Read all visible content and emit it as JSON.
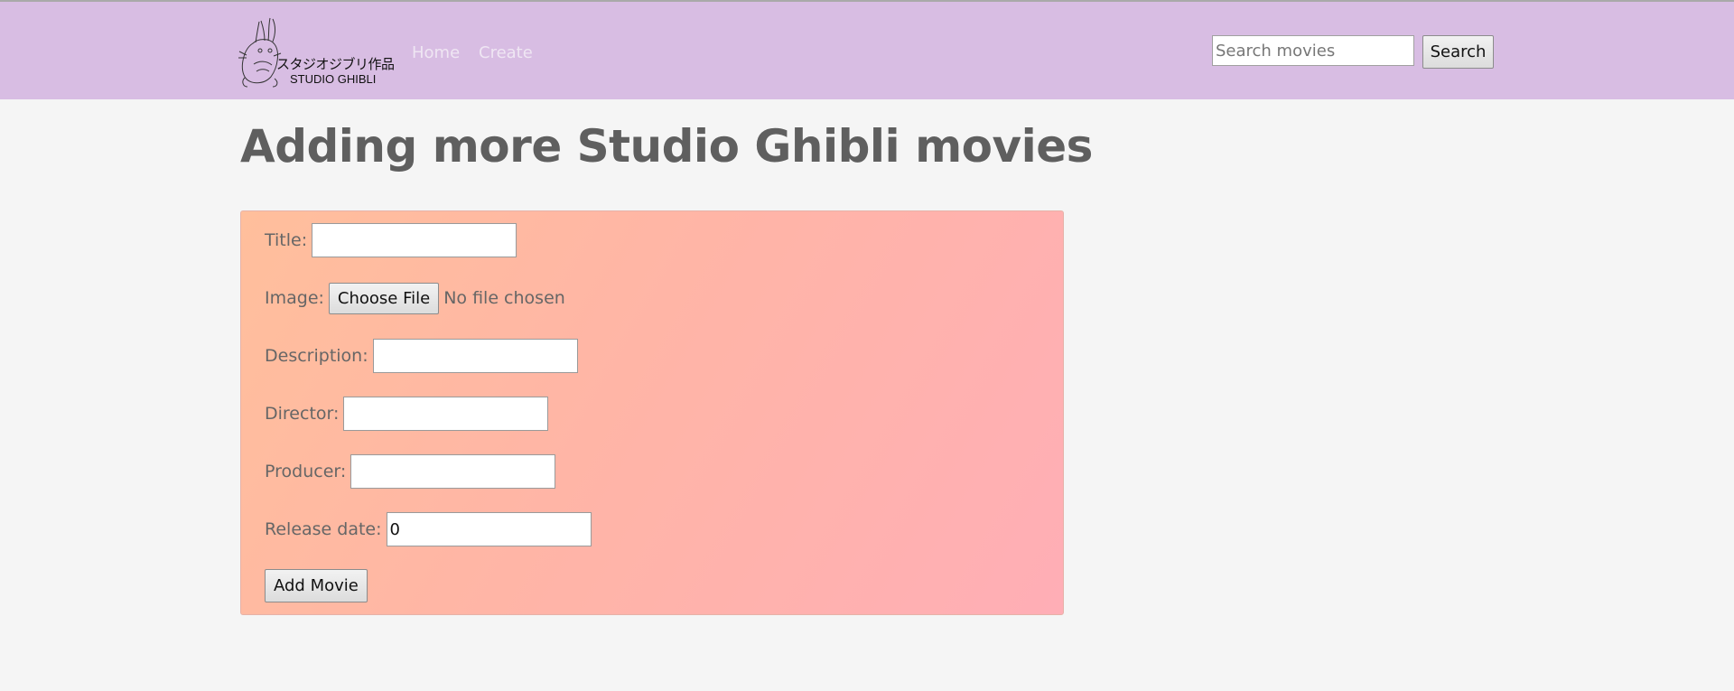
{
  "brand": {
    "logo_icon": "totoro-sketch-icon",
    "japanese_text": "スタジオジブリ作品",
    "english_text": "STUDIO GHIBLI"
  },
  "nav": {
    "home": "Home",
    "create": "Create"
  },
  "search": {
    "placeholder": "Search movies",
    "value": "",
    "button": "Search"
  },
  "page": {
    "title": "Adding more Studio Ghibli movies"
  },
  "form": {
    "title_label": "Title:",
    "title_value": "",
    "image_label": "Image:",
    "image_button": "Choose File",
    "image_status": "No file chosen",
    "description_label": "Description:",
    "description_value": "",
    "director_label": "Director:",
    "director_value": "",
    "producer_label": "Producer:",
    "producer_value": "",
    "release_label": "Release date:",
    "release_value": "0",
    "submit": "Add Movie"
  },
  "colors": {
    "navbar": "#d8bde3",
    "background": "#f5f5f5",
    "panel_gradient_start": "#ffbf9c",
    "panel_gradient_end": "#ffaeb6"
  }
}
